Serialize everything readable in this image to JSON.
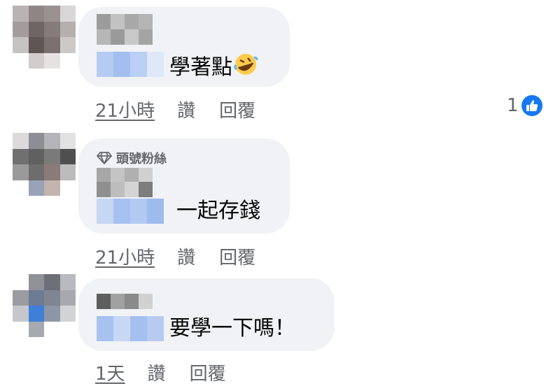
{
  "comments": [
    {
      "badge": "",
      "text": "學著點",
      "emoji": "rolling-on-floor-laughing-emoji",
      "time": "21小時",
      "like_label": "讚",
      "reply_label": "回覆",
      "reaction_count": "1",
      "reaction_icon": "thumbs-up-icon"
    },
    {
      "badge": "頭號粉絲",
      "badge_icon": "diamond-icon",
      "text": "一起存錢",
      "time": "21小時",
      "like_label": "讚",
      "reply_label": "回覆"
    },
    {
      "badge": "",
      "text": "要學一下嗎！",
      "time": "1天",
      "like_label": "讚",
      "reply_label": "回覆"
    }
  ],
  "colors": {
    "bubble": "#f0f2f5",
    "meta_text": "#65676b",
    "like_blue": "#1877f2",
    "mention_blur": "#a9c3ee"
  }
}
